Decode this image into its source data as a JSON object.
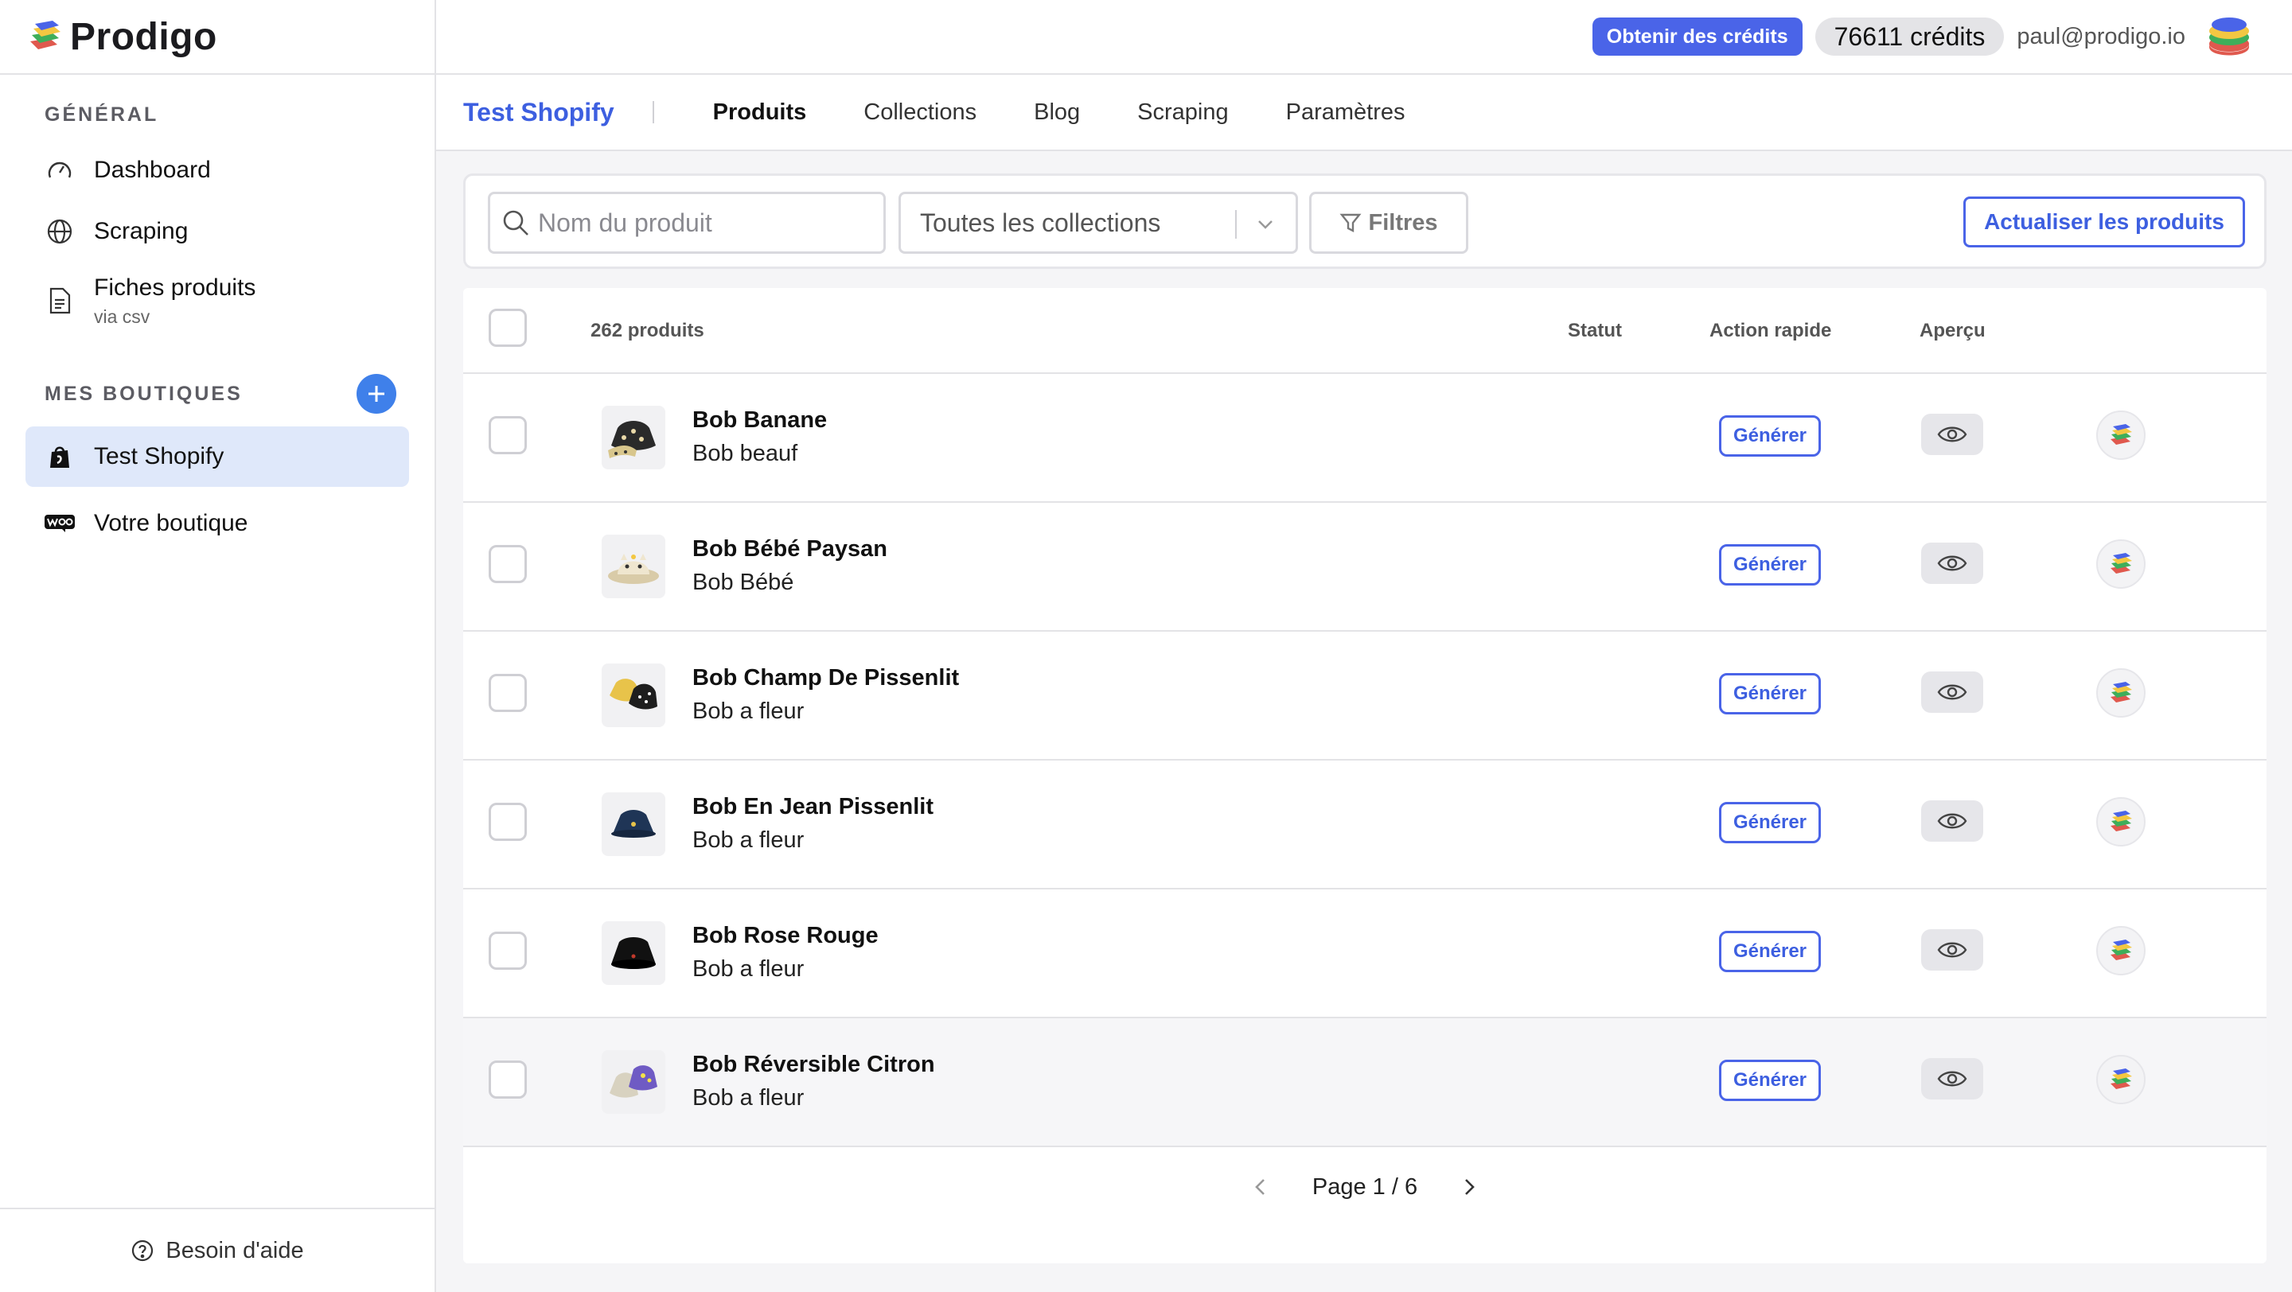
{
  "brand": {
    "name": "Prodigo"
  },
  "sidebar": {
    "general_title": "GÉNÉRAL",
    "general_items": [
      {
        "label": "Dashboard",
        "icon": "gauge-icon"
      },
      {
        "label": "Scraping",
        "icon": "globe-icon"
      },
      {
        "label": "Fiches produits",
        "sub": "via csv",
        "icon": "document-icon"
      }
    ],
    "stores_title": "MES BOUTIQUES",
    "stores": [
      {
        "label": "Test Shopify",
        "icon": "shopify-icon",
        "active": true
      },
      {
        "label": "Votre boutique",
        "icon": "woo-icon",
        "active": false
      }
    ],
    "help_label": "Besoin d'aide"
  },
  "topbar": {
    "get_credits_label": "Obtenir des crédits",
    "credits_label": "76611 crédits",
    "email": "paul@prodigo.io"
  },
  "tabsbar": {
    "store_name": "Test Shopify",
    "tabs": [
      {
        "label": "Produits",
        "active": true
      },
      {
        "label": "Collections",
        "active": false
      },
      {
        "label": "Blog",
        "active": false
      },
      {
        "label": "Scraping",
        "active": false
      },
      {
        "label": "Paramètres",
        "active": false
      }
    ]
  },
  "filters": {
    "search_placeholder": "Nom du produit",
    "collection_selected": "Toutes les collections",
    "filters_label": "Filtres",
    "refresh_label": "Actualiser les produits"
  },
  "table": {
    "headers": {
      "count": "262 produits",
      "status": "Statut",
      "quick_action": "Action rapide",
      "preview": "Aperçu"
    },
    "generate_label": "Générer",
    "rows": [
      {
        "name": "Bob Banane",
        "category": "Bob beauf"
      },
      {
        "name": "Bob Bébé Paysan",
        "category": "Bob Bébé"
      },
      {
        "name": "Bob Champ De Pissenlit",
        "category": "Bob a fleur"
      },
      {
        "name": "Bob En Jean Pissenlit",
        "category": "Bob a fleur"
      },
      {
        "name": "Bob Rose Rouge",
        "category": "Bob a fleur"
      },
      {
        "name": "Bob Réversible Citron",
        "category": "Bob a fleur"
      }
    ]
  },
  "pagination": {
    "label": "Page 1 / 6"
  },
  "colors": {
    "accent": "#4a64e8",
    "accent_text": "#3d5fe0",
    "active_nav_bg": "#dfe8fa"
  }
}
